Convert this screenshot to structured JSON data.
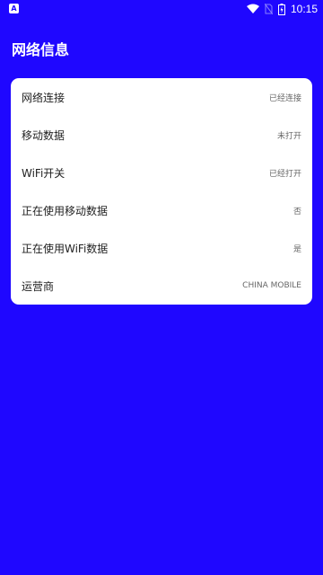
{
  "status_bar": {
    "time": "10:15",
    "left_icon": "a-notification-icon",
    "icons": [
      "wifi-icon",
      "no-sim-icon",
      "battery-charging-icon"
    ]
  },
  "header": {
    "title": "网络信息"
  },
  "info": {
    "rows": [
      {
        "label": "网络连接",
        "value": "已经连接"
      },
      {
        "label": "移动数据",
        "value": "未打开"
      },
      {
        "label": "WiFi开关",
        "value": "已经打开"
      },
      {
        "label": "正在使用移动数据",
        "value": "否"
      },
      {
        "label": "正在使用WiFi数据",
        "value": "是"
      },
      {
        "label": "运营商",
        "value": "CHINA MOBILE"
      }
    ]
  },
  "colors": {
    "background": "#1f07ff",
    "card": "#ffffff"
  }
}
